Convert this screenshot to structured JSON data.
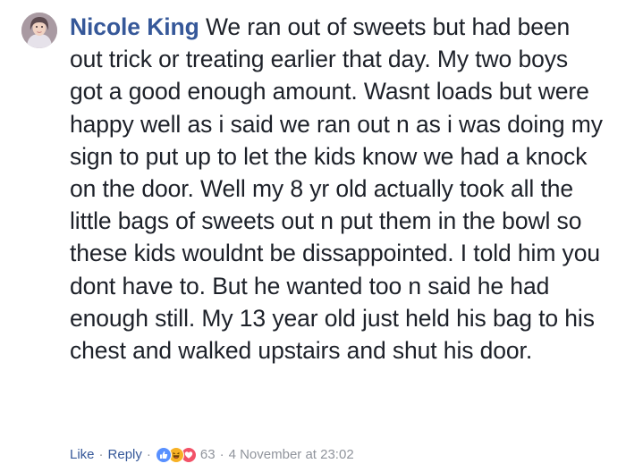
{
  "comment": {
    "author": "Nicole King",
    "text": "We ran out of sweets but had been out trick or treating earlier that day. My two boys got a good enough amount. Wasnt loads but were happy well as i said we ran out n as i was doing my sign to put up to let the kids know we had a knock on the door. Well my 8 yr old actually took all the little bags of sweets out n put them in the bowl so these kids wouldnt be dissappointed. I told him you dont have to. But he wanted too n said he had enough still. My 13 year old just held his bag to his chest and walked upstairs and shut his door.",
    "actions": {
      "like_label": "Like",
      "reply_label": "Reply",
      "separator": "·"
    },
    "reactions": {
      "icons": [
        "like-reaction-icon",
        "haha-reaction-icon",
        "love-reaction-icon"
      ],
      "count": "63"
    },
    "timestamp": "4 November at 23:02"
  },
  "colors": {
    "author_link": "#365899",
    "body_text": "#1d2129",
    "meta_text": "#90949c",
    "like_reaction": "#5890ff",
    "haha_reaction": "#f7b125",
    "love_reaction": "#f25268"
  }
}
